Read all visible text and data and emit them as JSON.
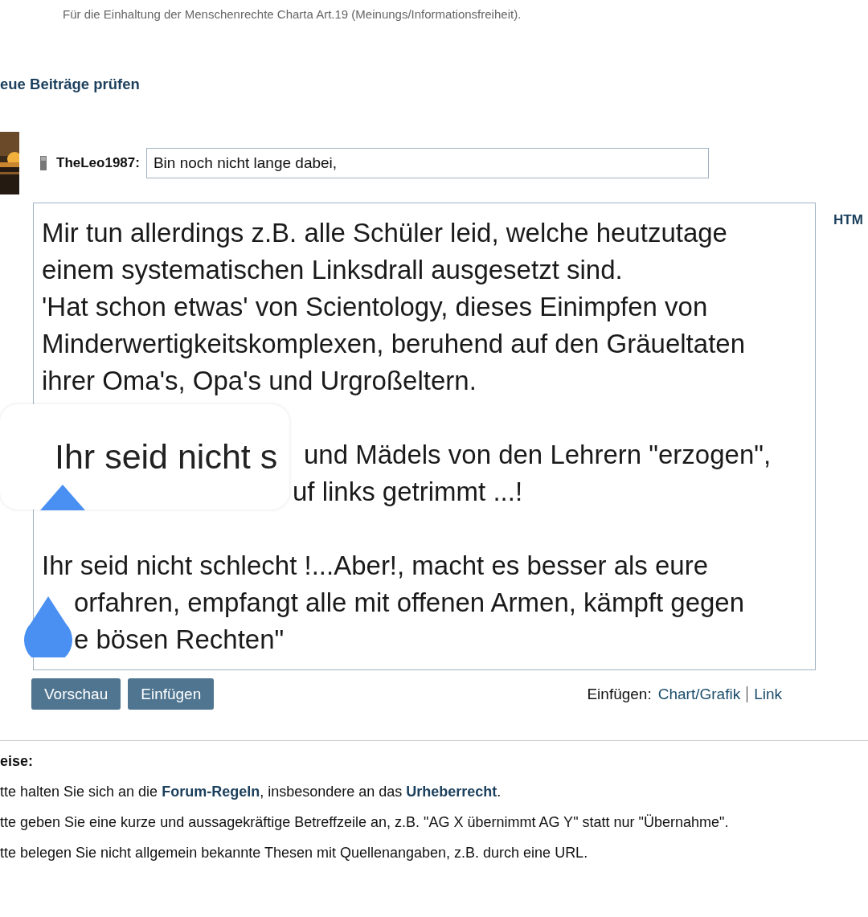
{
  "notice": "Für die Einhaltung der Menschenrechte Charta Art.19 (Meinungs/Informationsfreiheit).",
  "check_link": "eue Beiträge prüfen",
  "reply": {
    "avatar": {
      "kind": "picture"
    },
    "username": "TheLeo1987:",
    "subject": "Bin noch nicht lange dabei,",
    "html_tab": "HTM",
    "lines": [
      {
        "kind": "text",
        "text": "Mir tun allerdings z.B. alle Schüler leid, welche heutzutage"
      },
      {
        "kind": "text",
        "text": "einem systematischen Linksdrall ausgesetzt sind."
      },
      {
        "kind": "text",
        "text": "'Hat schon etwas' von Scientology, dieses Einimpfen von"
      },
      {
        "kind": "text",
        "text": "Minderwertigkeitskomplexen, beruhend auf den Gräueltaten"
      },
      {
        "kind": "text",
        "text": "ihrer Oma's, Opa's und Urgroßeltern."
      },
      {
        "kind": "blank"
      },
      {
        "kind": "beside_magnifier",
        "text": "und Mädels von den Lehrern \"erzogen\","
      },
      {
        "kind": "beside_magnifier",
        "text": "uf links getrimmt ...!"
      },
      {
        "kind": "blank"
      },
      {
        "kind": "text",
        "text": "Ihr seid nicht schlecht !...Aber!, macht es besser als eure"
      },
      {
        "kind": "beside_handle",
        "text": "orfahren, empfangt alle mit offenen Armen, kämpft gegen"
      },
      {
        "kind": "beside_handle",
        "text": "e bösen Rechten\""
      }
    ],
    "magnifier": "Ihr seid nicht s",
    "buttons": [
      "Vorschau",
      "Einfügen"
    ],
    "insert_label": "Einfügen:",
    "insert_links": [
      "Chart/Grafik",
      "Link"
    ]
  },
  "hints": {
    "title": "eise:",
    "items": [
      "tte halten Sie sich an die **Forum-Regeln**, insbesondere an das **Urheberrecht**.",
      "tte geben Sie eine kurze und aussagekräftige Betreffzeile an, z.B. \"AG X übernimmt AG Y\" statt nur \"Übernahme\".",
      "tte belegen Sie nicht allgemein bekannte Thesen mit Quellenangaben, z.B. durch eine URL."
    ]
  }
}
